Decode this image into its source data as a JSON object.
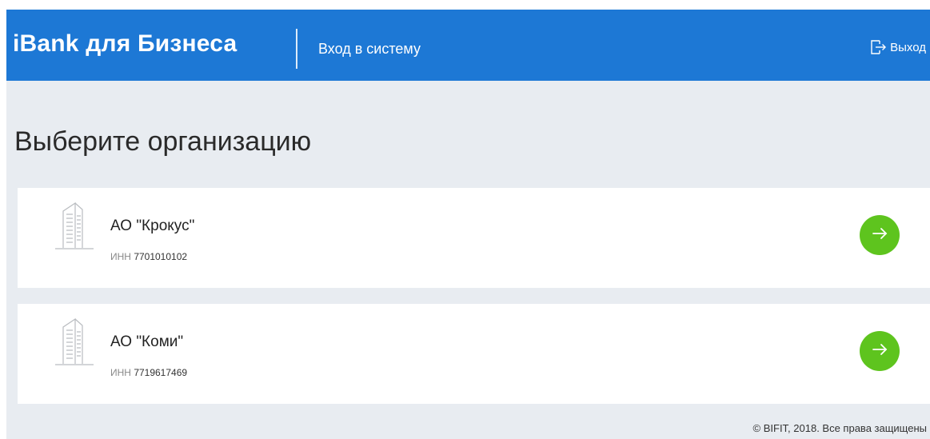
{
  "header": {
    "brand": "iBank для Бизнеса",
    "subtitle": "Вход в систему",
    "logout_label": "Выход",
    "background_color": "#1d78d5"
  },
  "main": {
    "heading": "Выберите организацию",
    "organizations": [
      {
        "name": "АО \"Крокус\"",
        "inn_label": "ИНН",
        "inn_value": "7701010102",
        "icon": "building-icon",
        "action_icon": "arrow-right-icon"
      },
      {
        "name": "АО \"Коми\"",
        "inn_label": "ИНН",
        "inn_value": "7719617469",
        "icon": "building-icon",
        "action_icon": "arrow-right-icon"
      }
    ],
    "action_color": "#5ec41e",
    "background_color": "#e8ecf1"
  },
  "footer": {
    "copyright": "© BIFIT, 2018. Все права защищены"
  }
}
